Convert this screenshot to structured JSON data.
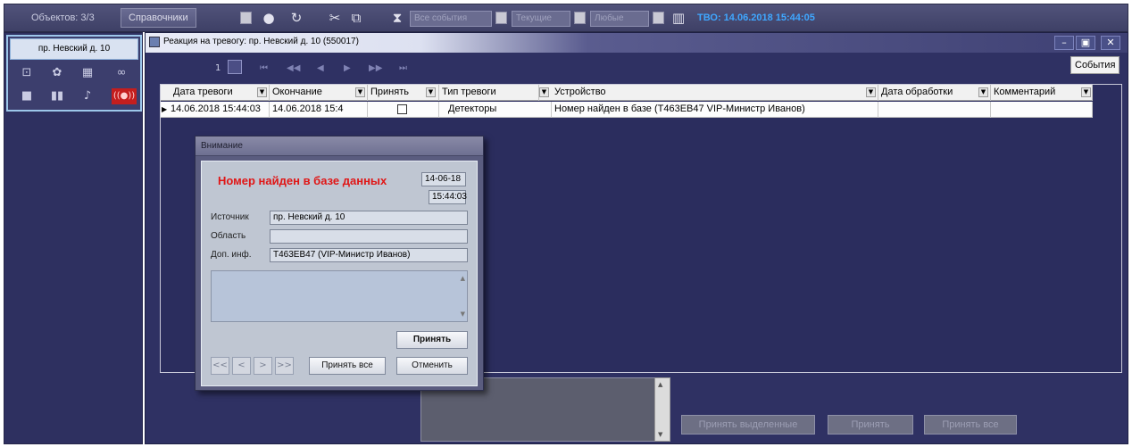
{
  "topbar": {
    "objects_label": "Объектов: 3/3",
    "reference_button": "Справочники",
    "filters": {
      "all_events": "Все события",
      "current": "Текущие",
      "any": "Любые"
    },
    "tvo_status": "ТВО: 14.06.2018 15:44:05",
    "icons": [
      "menu-icon",
      "info-icon",
      "refresh-icon",
      "scissors-icon",
      "copy-icon",
      "filter-icon",
      "book-icon"
    ]
  },
  "left_panel": {
    "object_tab": "пр. Невский д. 10",
    "icons": [
      "monitor-icon",
      "gear-icon",
      "server-icon",
      "tape-icon",
      "camera-icon",
      "pause-icon",
      "alarm-bell-icon",
      "alarm-signal-icon"
    ]
  },
  "window": {
    "title": "Реакция на тревогу: пр. Невский д. 10 (550017)",
    "page_number": "1",
    "events_button": "События",
    "table": {
      "columns": [
        "Дата тревоги",
        "Окончание",
        "Принять",
        "Тип тревоги",
        "Устройство",
        "Дата обработки",
        "Комментарий"
      ],
      "rows": [
        {
          "alarm_date": "14.06.2018 15:44:03",
          "end": "14.06.2018 15:4",
          "accept": false,
          "alarm_type": "Детекторы",
          "device": "Номер найден в базе (Т463ЕВ47 VIP-Министр Иванов)",
          "processed": "",
          "comment": ""
        }
      ]
    },
    "bottom_buttons": {
      "accept_selected": "Принять выделенные",
      "accept": "Принять",
      "accept_all": "Принять все"
    }
  },
  "dialog": {
    "title": "Внимание",
    "heading": "Номер найден в базе данных",
    "date": "14-06-18",
    "time": "15:44:03",
    "source_label": "Источник",
    "source_value": "пр. Невский д. 10",
    "area_label": "Область",
    "area_value": "",
    "info_label": "Доп. инф.",
    "info_value": "Т463ЕВ47 (VIP-Министр Иванов)",
    "accept_button": "Принять",
    "accept_all_button": "Принять все",
    "cancel_button": "Отменить",
    "nav": [
      "<<",
      "<",
      ">",
      ">>"
    ]
  },
  "colors": {
    "accent_red": "#e01616",
    "tvo_blue": "#3fa7ff",
    "panel_bg": "#2f3163"
  }
}
